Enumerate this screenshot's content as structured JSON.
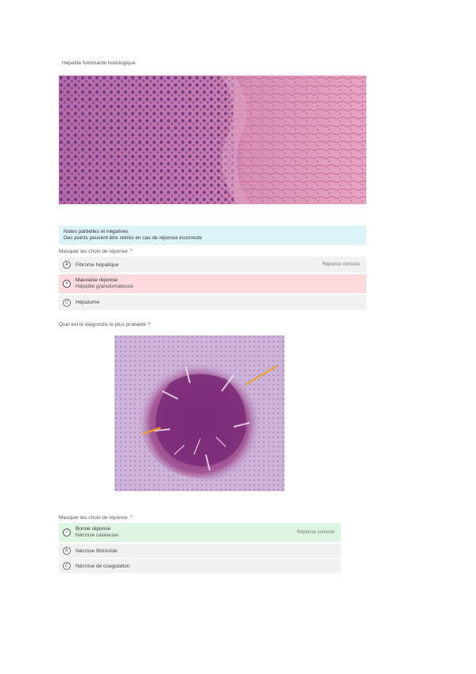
{
  "section1": {
    "caption": "Hépatite fulminante histologique"
  },
  "note": {
    "title": "Notes partielles et négatives",
    "text": "Des points peuvent être retirés en cas de réponse incorrecte"
  },
  "question1": {
    "prompt": "Masquer les choix de réponse",
    "options": [
      {
        "letter": "A",
        "label": "Fibrome hépatique",
        "tag": "Réponse correcte"
      },
      {
        "letter": "✕",
        "title": "Mauvaise réponse",
        "label": "Hépatite granulomateuse"
      },
      {
        "letter": "C",
        "label": "Hépatome"
      }
    ]
  },
  "question2": {
    "prompt": "Quel est le diagnostic le plus probable ?",
    "show_label": "Masquer les choix de réponse",
    "options": [
      {
        "letter": "✓",
        "title": "Bonne réponse",
        "label": "Nécrose caséeuse",
        "tag": "Réponse correcte"
      },
      {
        "letter": "B",
        "label": "Nécrose fibrinoïde"
      },
      {
        "letter": "C",
        "label": "Nécrose de coagulation"
      }
    ]
  },
  "colors": {
    "note_bg": "#dcf3f8",
    "wrong_bg": "#fadadd",
    "correct_bg": "#def5e3",
    "neutral_bg": "#f1f1f1",
    "arrow": "#f0a020"
  }
}
